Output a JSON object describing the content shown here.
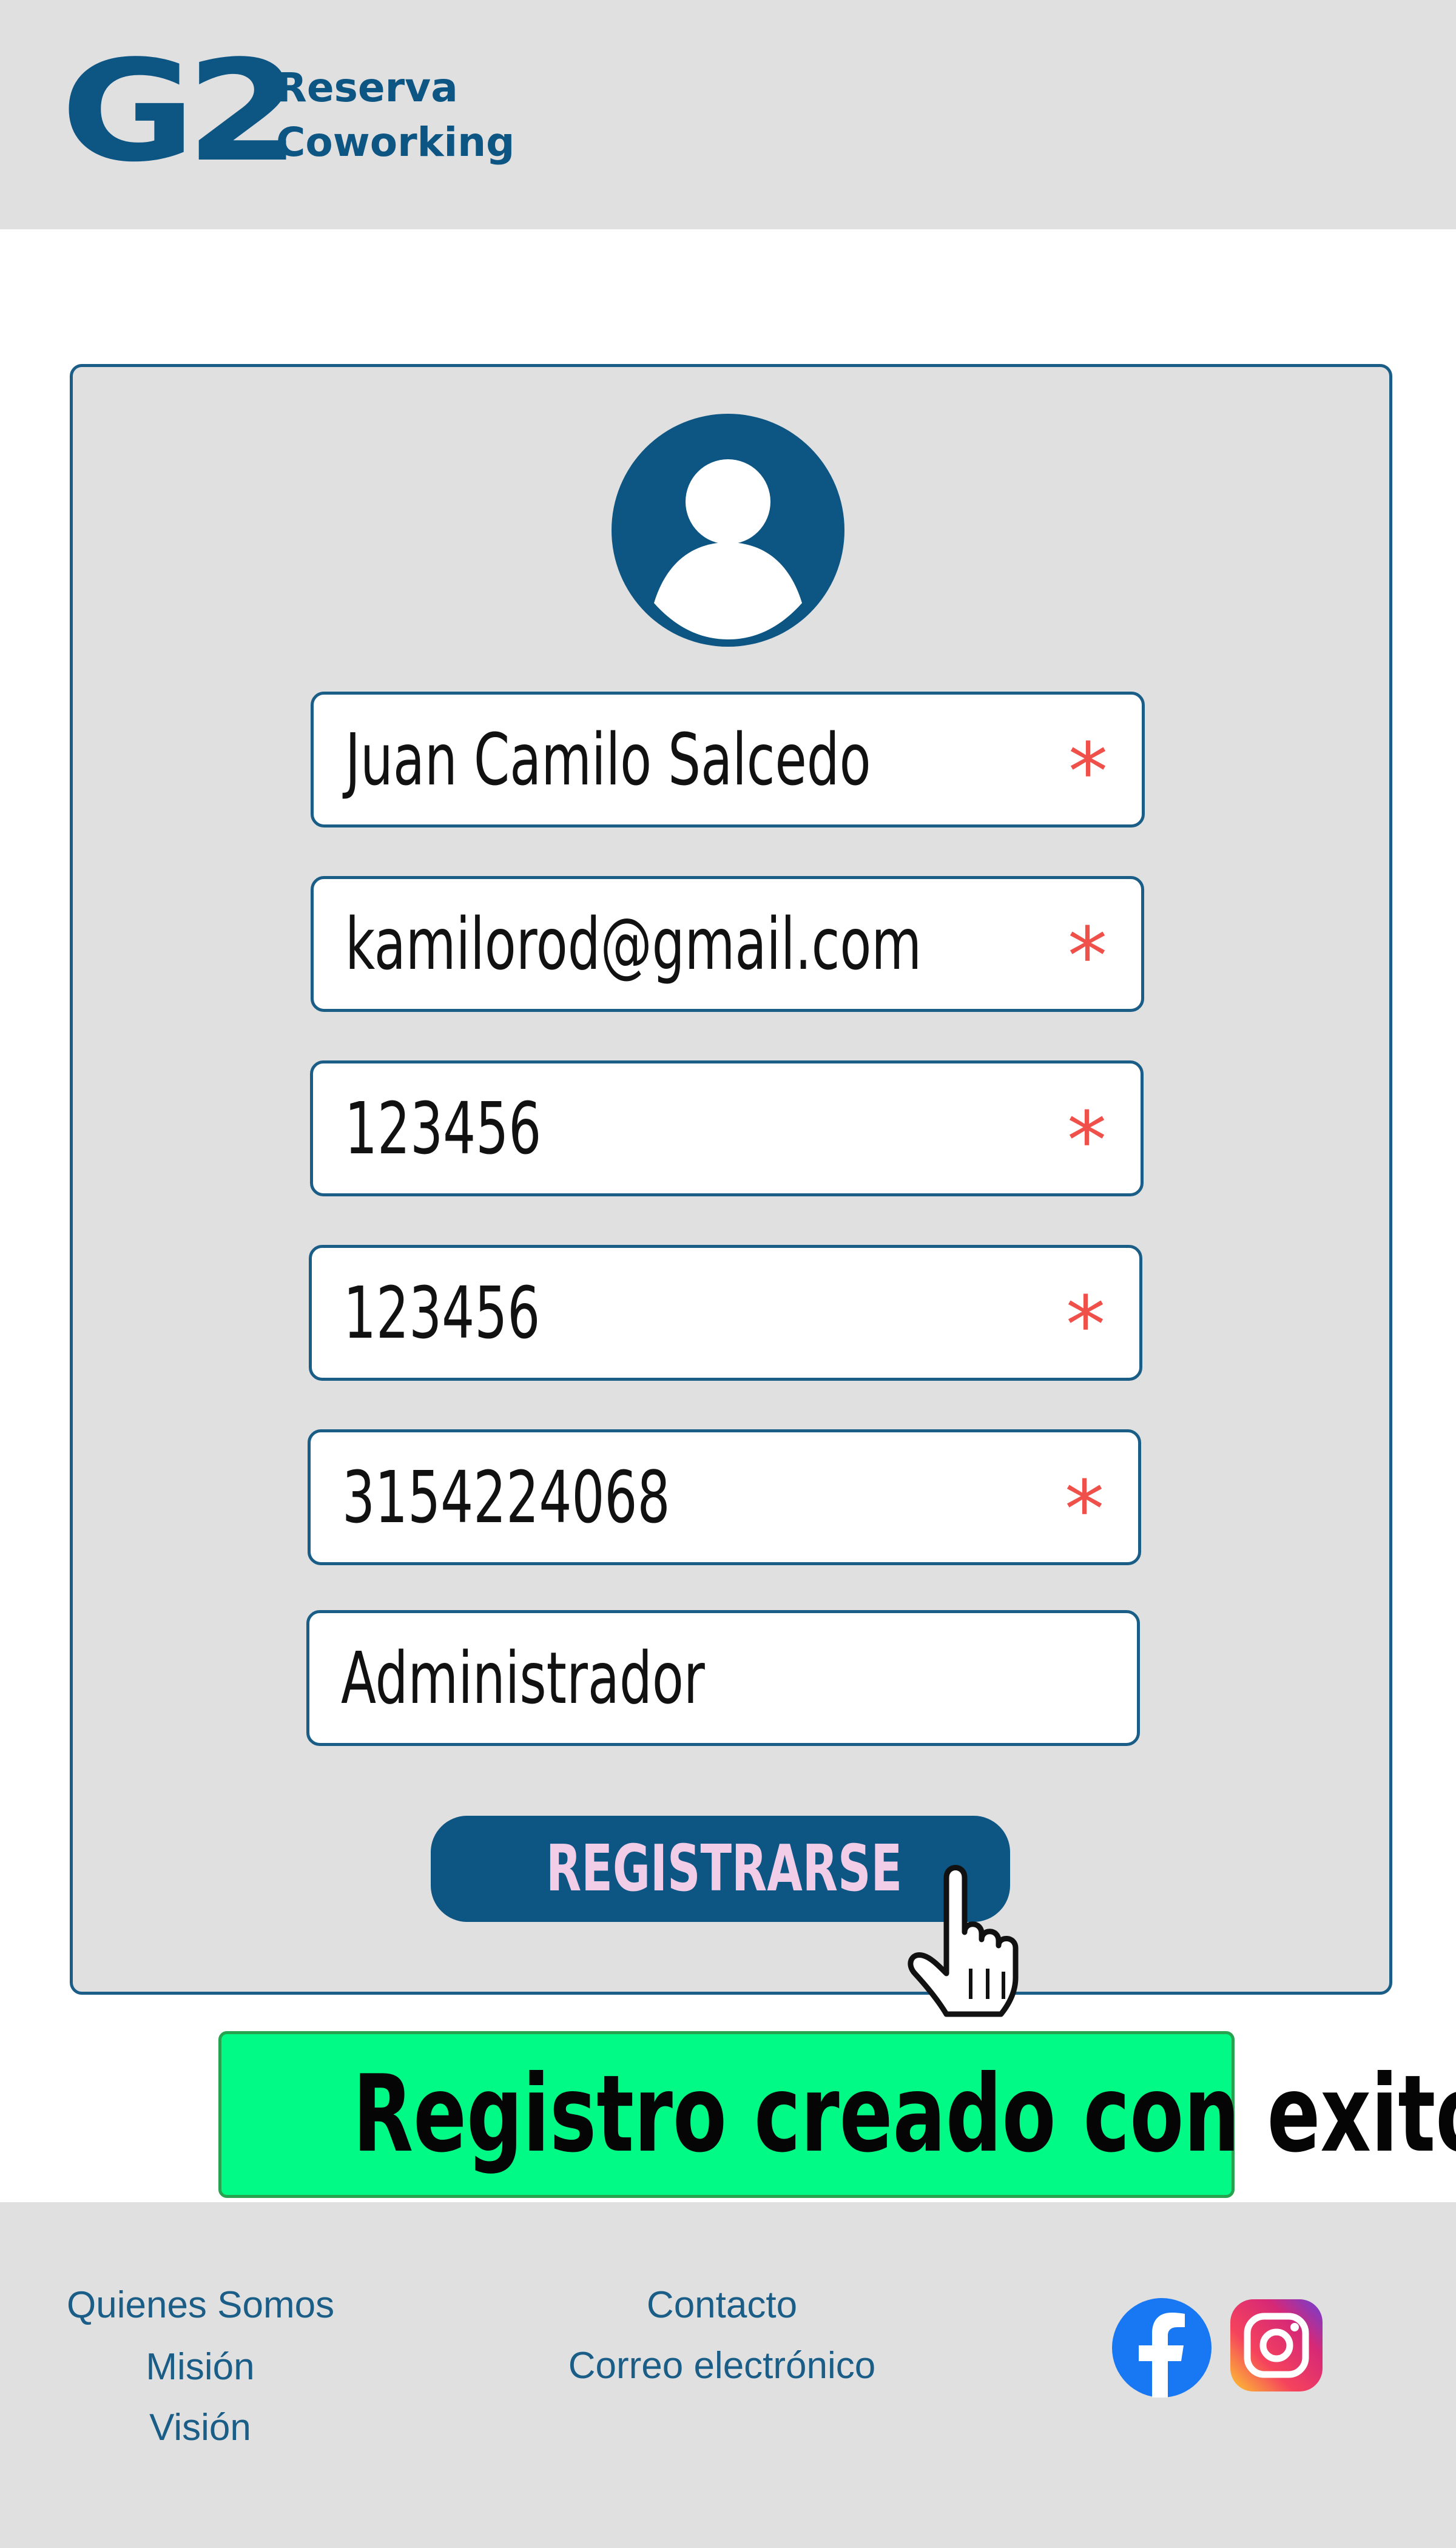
{
  "brand": {
    "mark": "G2",
    "name_line1": "Reserva",
    "name_line2": "Coworking",
    "color": "#0d5583"
  },
  "form": {
    "avatar_icon": "user-avatar-icon",
    "fields": [
      {
        "value": "Juan Camilo Salcedo",
        "required_mark": "*"
      },
      {
        "value": "kamilorod@gmail.com",
        "required_mark": "*"
      },
      {
        "value": "123456",
        "required_mark": "*"
      },
      {
        "value": "123456",
        "required_mark": "*"
      },
      {
        "value": "3154224068",
        "required_mark": "*"
      },
      {
        "value": "Administrador"
      }
    ],
    "submit_label": "REGISTRARSE",
    "pointer_icon": "hand-pointer-icon"
  },
  "toast": {
    "message": "Registro creado con exito",
    "color": "#00fa85"
  },
  "footer": {
    "col1": [
      "Quienes Somos",
      "Misión",
      "Visión"
    ],
    "col2": [
      "Contacto",
      "Correo electrónico"
    ],
    "social": [
      "facebook-icon",
      "instagram-icon"
    ]
  },
  "colors": {
    "primary": "#0d5583",
    "required": "#f0504a",
    "panel": "#e0e0e1"
  }
}
